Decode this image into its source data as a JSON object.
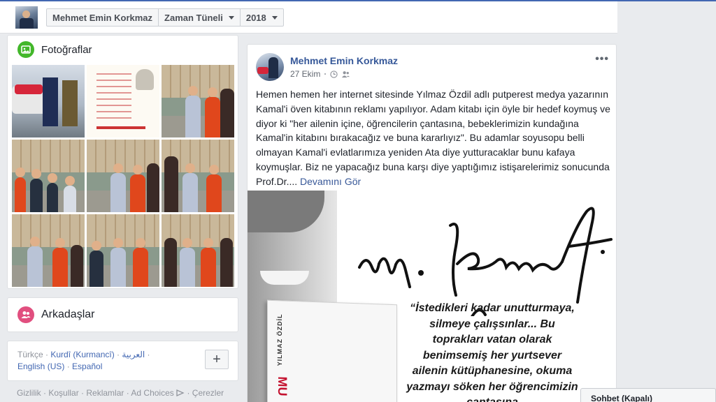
{
  "nav": {
    "name": "Mehmet Emin Korkmaz",
    "section": "Zaman Tüneli",
    "year": "2018"
  },
  "photos": {
    "title": "Fotoğraflar",
    "icon": "photo-icon"
  },
  "friends": {
    "title": "Arkadaşlar",
    "icon": "friends-icon"
  },
  "languages": {
    "current": "Türkçe",
    "items": [
      "Kurdî (Kurmancî)",
      "العربية",
      "English (US)",
      "Español"
    ]
  },
  "footer": {
    "links": [
      "Gizlilik",
      "Koşullar",
      "Reklamlar",
      "Ad Choices",
      "Çerezler"
    ]
  },
  "post": {
    "author": "Mehmet Emin Korkmaz",
    "date": "27 Ekim",
    "text": "Hemen hemen her internet sitesinde Yılmaz Özdil adlı putperest medya yazarının Kamal'i öven kitabının reklamı yapılıyor. Adam kitabı için öyle bir hedef koymuş ve diyor ki \"her ailenin içine, öğrencilerin çantasına, bebeklerimizin kundağına Kamal'in kitabını bırakacağız ve buna kararlıyız\". Bu adamlar soyusopu belli olmayan Kamal'i evlatlarımıza yeniden Ata diye yutturacaklar bunu kafaya koymuşlar. Biz ne yapacağız buna karşı diye yaptığımız istişarelerimiz sonucunda Prof.Dr....",
    "see_more": "Devamını Gör",
    "image": {
      "signature": "M. Kemal",
      "book_author": "YILMAZ ÖZDİL",
      "book_title": "MU",
      "quote": "“İstedikleri kadar unutturmaya, silmeye çalışsınlar... Bu toprakları vatan olarak benimsemiş her yurtsever ailenin kütüphanesine, okuma yazmayı söken her öğrencimizin çantasına"
    }
  },
  "chat": {
    "label": "Sohbet (Kapalı)"
  },
  "colors": {
    "link": "#365899",
    "photo_icon_bg": "#42b72a",
    "friends_icon_bg": "#e14f7f"
  }
}
